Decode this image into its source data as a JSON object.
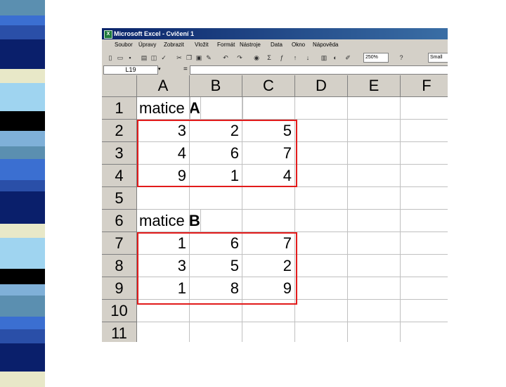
{
  "window": {
    "title": "Microsoft Excel - Cvičení 1",
    "icon": "excel-icon"
  },
  "menu": [
    "Soubor",
    "Úpravy",
    "Zobrazit",
    "Vložit",
    "Formát",
    "Nástroje",
    "Data",
    "Okno",
    "Nápověda"
  ],
  "toolbar": {
    "zoom": "250%",
    "font": "Small"
  },
  "formula_bar": {
    "name_box": "L19",
    "eq": "=",
    "value": ""
  },
  "columns": [
    "A",
    "B",
    "C",
    "D",
    "E",
    "F"
  ],
  "rows": [
    "1",
    "2",
    "3",
    "4",
    "5",
    "6",
    "7",
    "8",
    "9",
    "10",
    "11"
  ],
  "cells": {
    "r1": {
      "prefix": "matice ",
      "bold": "A"
    },
    "r2": [
      "3",
      "2",
      "5"
    ],
    "r3": [
      "4",
      "6",
      "7"
    ],
    "r4": [
      "9",
      "1",
      "4"
    ],
    "r6": {
      "prefix": "matice ",
      "bold": "B"
    },
    "r7": [
      "1",
      "6",
      "7"
    ],
    "r8": [
      "3",
      "5",
      "2"
    ],
    "r9": [
      "1",
      "8",
      "9"
    ]
  },
  "colors": {
    "highlight": "#e21b1b",
    "strip_dark": "#0a1f6b",
    "strip_light": "#9fd4f0"
  }
}
